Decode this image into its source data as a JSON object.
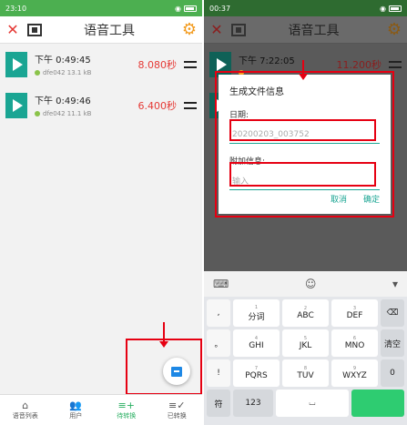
{
  "left": {
    "status": {
      "time": "23:10",
      "signal": "5ll 5ll HD",
      "wifi": "wifi-icon",
      "battery": "battery-icon"
    },
    "appbar": {
      "title": "语音工具"
    },
    "items": [
      {
        "time": "下午 0:49:45",
        "info": "dfe042 13.1 kB",
        "duration": "8.080秒"
      },
      {
        "time": "下午 0:49:46",
        "info": "dfe042 11.1 kB",
        "duration": "6.400秒"
      }
    ],
    "tabs": [
      {
        "icon": "⌂",
        "label": "语音列表"
      },
      {
        "icon": "👥",
        "label": "用户"
      },
      {
        "icon": "≡+",
        "label": "待转换"
      },
      {
        "icon": "≡✓",
        "label": "已转换"
      }
    ]
  },
  "right": {
    "status": {
      "time": "00:37",
      "signal": "5ll 5ll HD"
    },
    "appbar": {
      "title": "语音工具"
    },
    "items": [
      {
        "time": "下午 7:22:05",
        "duration": "11.200秒"
      },
      {
        "time": "",
        "duration": ""
      }
    ],
    "dialog": {
      "title": "生成文件信息",
      "date_label": "日期:",
      "date_value": "20200203_003752",
      "extra_label": "附加信息:",
      "extra_placeholder": "输入",
      "cancel": "取消",
      "ok": "确定"
    },
    "keyboard": {
      "rows": [
        [
          {
            "n": "",
            "t": ","
          },
          {
            "n": "1",
            "t": "分词"
          },
          {
            "n": "2",
            "t": "ABC"
          },
          {
            "n": "3",
            "t": "DEF"
          },
          {
            "n": "",
            "t": "⌫"
          }
        ],
        [
          {
            "n": "",
            "t": "。"
          },
          {
            "n": "4",
            "t": "GHI"
          },
          {
            "n": "5",
            "t": "JKL"
          },
          {
            "n": "6",
            "t": "MNO"
          },
          {
            "n": "",
            "t": "清空"
          }
        ],
        [
          {
            "n": "",
            "t": "!"
          },
          {
            "n": "7",
            "t": "PQRS"
          },
          {
            "n": "8",
            "t": "TUV"
          },
          {
            "n": "9",
            "t": "WXYZ"
          },
          {
            "n": "",
            "t": "0"
          }
        ],
        [
          {
            "n": "",
            "t": "符"
          },
          {
            "n": "",
            "t": "123"
          },
          {
            "n": "",
            "t": "⌴"
          },
          {
            "n": "",
            "t": ""
          },
          {
            "n": "",
            "t": ""
          }
        ]
      ]
    }
  }
}
